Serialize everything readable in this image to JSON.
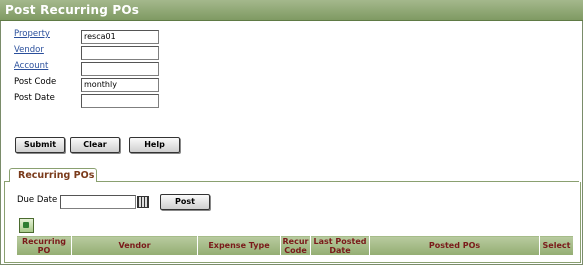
{
  "window": {
    "title": "Post Recurring POs"
  },
  "form": {
    "property_label": "Property",
    "property_value": "resca01",
    "vendor_label": "Vendor",
    "vendor_value": "",
    "account_label": "Account",
    "account_value": "",
    "postcode_label": "Post Code",
    "postcode_value": "monthly",
    "postdate_label": "Post Date",
    "postdate_value": ""
  },
  "actions": {
    "submit": "Submit",
    "clear": "Clear",
    "help": "Help"
  },
  "tabs": [
    {
      "label": "Recurring POs",
      "active": true
    }
  ],
  "recurring": {
    "due_date_label": "Due Date",
    "due_date_value": "",
    "post_button": "Post",
    "columns": [
      "Recurring PO",
      "Vendor",
      "Expense Type",
      "Recur Code",
      "Last Posted Date",
      "Posted POs",
      "Select"
    ]
  },
  "colors": {
    "title_bar": "#8fa878",
    "header_text": "#7a1a1a",
    "link": "#2a4f9c",
    "tab_text": "#7a3a1a"
  },
  "icons": {
    "calendar": "calendar-icon",
    "export": "excel-export-icon"
  }
}
